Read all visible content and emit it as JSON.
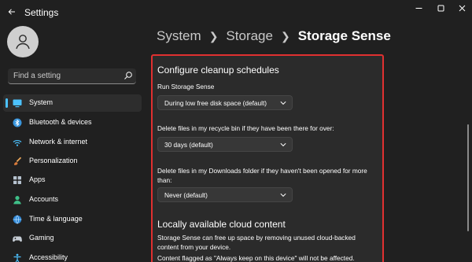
{
  "app": {
    "title": "Settings",
    "window_controls": [
      "minimize-icon",
      "maximize-icon",
      "close-icon"
    ]
  },
  "search": {
    "placeholder": "Find a setting"
  },
  "sidebar": {
    "items": [
      {
        "label": "System",
        "icon": "monitor-icon",
        "active": true
      },
      {
        "label": "Bluetooth & devices",
        "icon": "bluetooth-icon"
      },
      {
        "label": "Network & internet",
        "icon": "wifi-icon"
      },
      {
        "label": "Personalization",
        "icon": "brush-icon"
      },
      {
        "label": "Apps",
        "icon": "apps-icon"
      },
      {
        "label": "Accounts",
        "icon": "person-icon"
      },
      {
        "label": "Time & language",
        "icon": "globe-icon"
      },
      {
        "label": "Gaming",
        "icon": "gamepad-icon"
      },
      {
        "label": "Accessibility",
        "icon": "accessibility-icon"
      }
    ]
  },
  "breadcrumb": [
    "System",
    "Storage",
    "Storage Sense"
  ],
  "main": {
    "cleanup": {
      "title": "Configure cleanup schedules",
      "run_label": "Run Storage Sense",
      "run_value": "During low free disk space (default)",
      "recycle_label": "Delete files in my recycle bin if they have been there for over:",
      "recycle_value": "30 days (default)",
      "downloads_label": "Delete files in my Downloads folder if they haven't been opened for more than:",
      "downloads_value": "Never (default)"
    },
    "cloud": {
      "title": "Locally available cloud content",
      "desc": "Storage Sense can free up space by removing unused cloud-backed content from your device.",
      "note": "Content flagged as \"Always keep on this device\" will not be affected."
    }
  },
  "colors": {
    "background": "#202020",
    "card": "#2b2b2b",
    "accent": "#4cc2ff",
    "highlight_border": "#e03030"
  }
}
